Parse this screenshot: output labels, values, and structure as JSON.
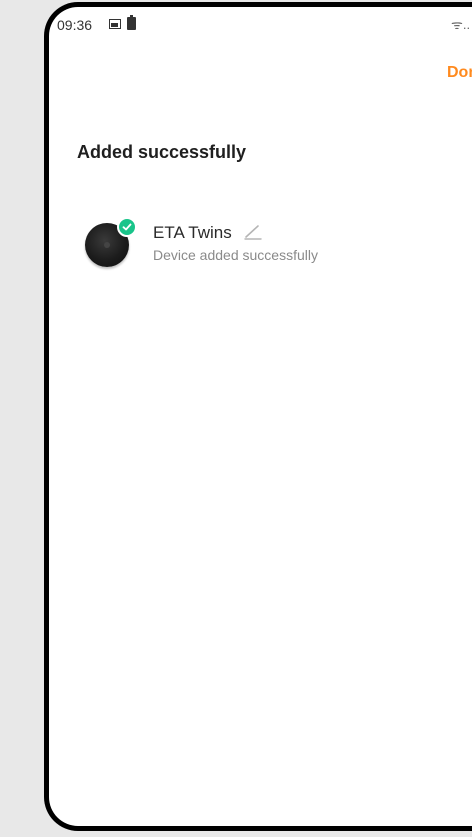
{
  "status_bar": {
    "time": "09:36",
    "right_text": "ᯤ.."
  },
  "header": {
    "done_label": "Done"
  },
  "main": {
    "title": "Added successfully",
    "device": {
      "name": "ETA Twins",
      "status": "Device added successfully",
      "badge_color": "#19c48a"
    }
  },
  "colors": {
    "accent": "#ff8a1e",
    "success": "#19c48a"
  },
  "icons": {
    "status_left": [
      "image-icon",
      "battery-icon"
    ],
    "status_right": [
      "wifi-icon"
    ],
    "device": [
      "check-icon",
      "edit-icon"
    ]
  }
}
